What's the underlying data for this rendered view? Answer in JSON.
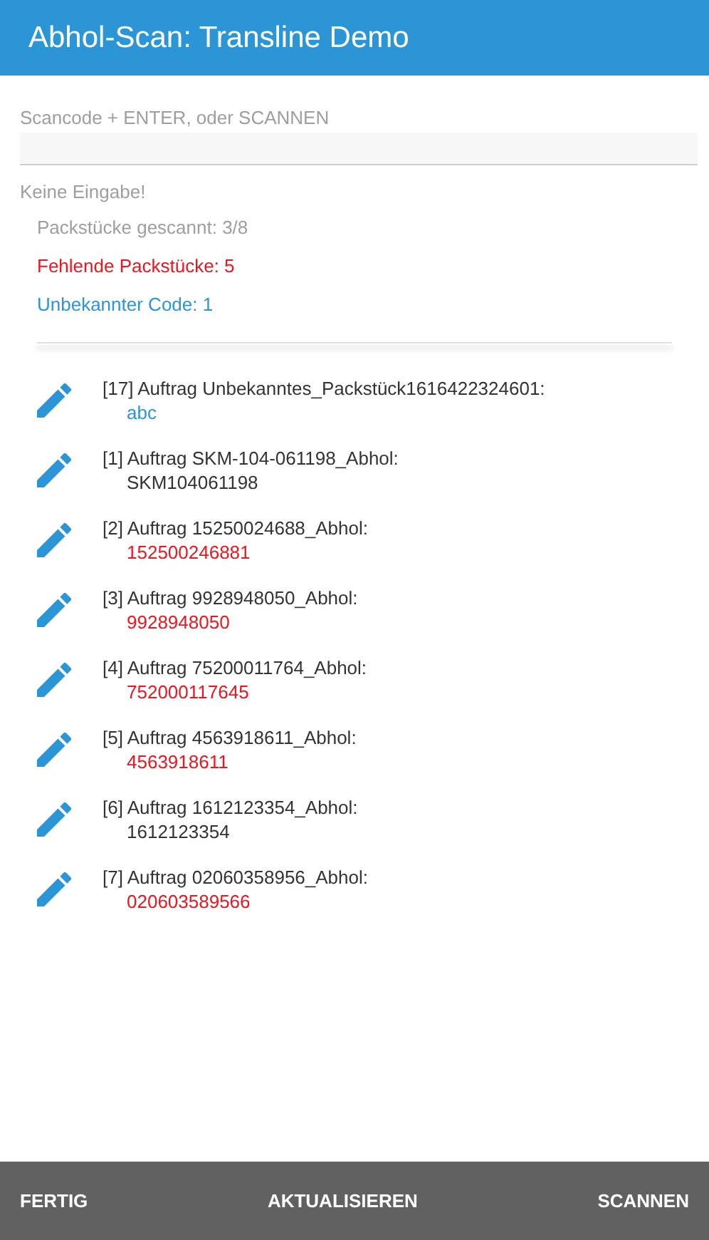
{
  "header": {
    "title": "Abhol-Scan: Transline Demo"
  },
  "scan_field": {
    "label": "Scancode + ENTER, oder SCANNEN"
  },
  "hint": "Keine Eingabe!",
  "stats": [
    {
      "text": "Packstücke gescannt: 3/8",
      "kind": "neutral"
    },
    {
      "text": "Fehlende Packstücke: 5",
      "kind": "missing"
    },
    {
      "text": "Unbekannter Code: 1",
      "kind": "unknown"
    }
  ],
  "items": [
    {
      "title": "[17] Auftrag Unbekanntes_Packstück1616422324601:",
      "code": "abc",
      "kind": "unknown"
    },
    {
      "title": "[1] Auftrag SKM-104-061198_Abhol:",
      "code": "SKM104061198",
      "kind": "scanned"
    },
    {
      "title": "[2] Auftrag 15250024688_Abhol:",
      "code": "152500246881",
      "kind": "missing"
    },
    {
      "title": "[3] Auftrag 9928948050_Abhol:",
      "code": "9928948050",
      "kind": "missing"
    },
    {
      "title": "[4] Auftrag 75200011764_Abhol:",
      "code": "752000117645",
      "kind": "missing"
    },
    {
      "title": "[5] Auftrag 4563918611_Abhol:",
      "code": "4563918611",
      "kind": "missing"
    },
    {
      "title": "[6] Auftrag 1612123354_Abhol:",
      "code": "1612123354",
      "kind": "scanned"
    },
    {
      "title": "[7] Auftrag 02060358956_Abhol:",
      "code": "020603589566",
      "kind": "missing"
    }
  ],
  "footer": {
    "buttons": [
      "FERTIG",
      "AKTUALISIEREN",
      "SCANNEN"
    ]
  }
}
